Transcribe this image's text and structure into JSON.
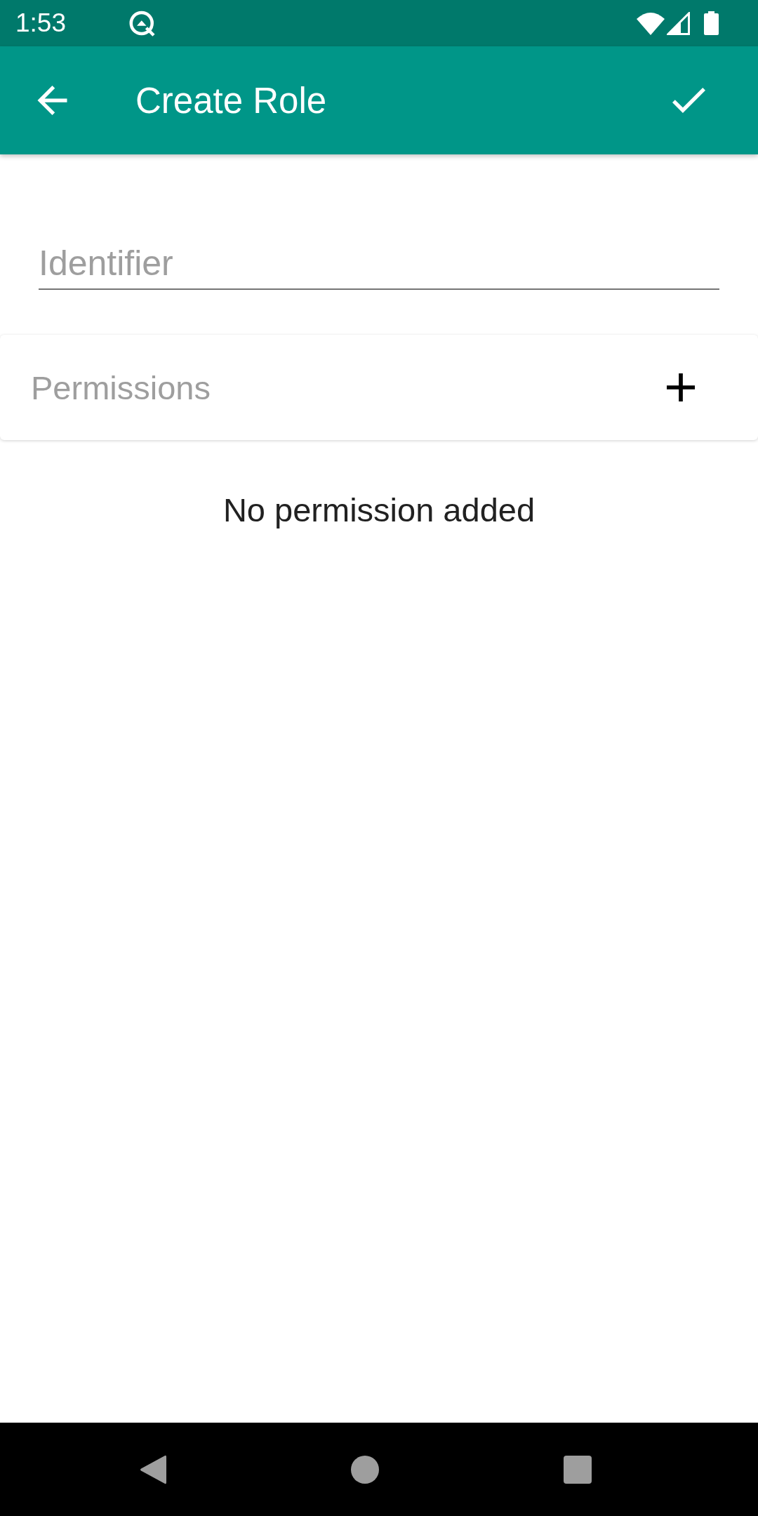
{
  "status_bar": {
    "time": "1:53"
  },
  "app_bar": {
    "title": "Create Role"
  },
  "identifier_field": {
    "placeholder": "Identifier"
  },
  "permissions": {
    "label": "Permissions",
    "empty_message": "No permission added"
  }
}
